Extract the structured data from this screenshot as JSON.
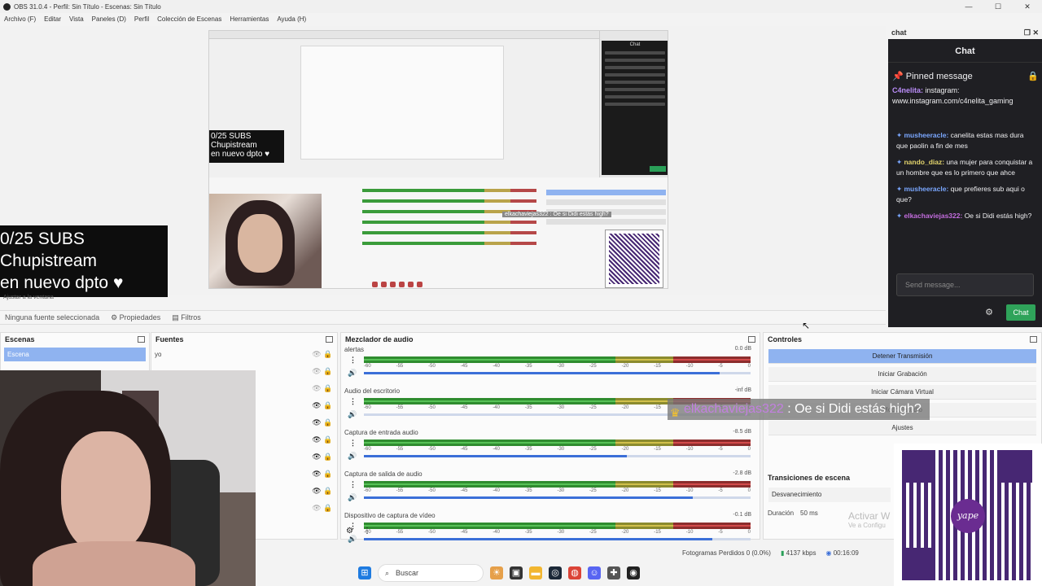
{
  "window": {
    "title": "OBS 31.0.4 - Perfil: Sin Título - Escenas: Sin Título",
    "menu": [
      "Archivo (F)",
      "Editar",
      "Vista",
      "Paneles (D)",
      "Perfil",
      "Colección de Escenas",
      "Herramientas",
      "Ayuda (H)"
    ]
  },
  "preview": {
    "subs_overlay": [
      "0/25 SUBS",
      "Chupistream",
      "en nuevo dpto ♥"
    ],
    "mini_chat_title": "Chat",
    "mini_alert": "elkachaviejas322 : Oe si Didi estás high?",
    "zoom_label": "Ajustar a la ventana"
  },
  "source_toolbar": {
    "no_source": "Ninguna fuente seleccionada",
    "properties": "Propiedades",
    "filters": "Filtros"
  },
  "scenes": {
    "title": "Escenas",
    "items": [
      "Escena"
    ]
  },
  "sources": {
    "title": "Fuentes",
    "items": [
      {
        "name": "yo"
      },
      {
        "name": ""
      },
      {
        "name": ""
      },
      {
        "name": ""
      },
      {
        "name": ""
      },
      {
        "name": ""
      },
      {
        "name": ""
      },
      {
        "name": ""
      },
      {
        "name": ""
      },
      {
        "name": ""
      }
    ]
  },
  "mixer": {
    "title": "Mezclador de audio",
    "channels": [
      {
        "name": "alertas",
        "db": "0.0 dB",
        "volume": 0.92
      },
      {
        "name": "Audio del escritorio",
        "db": "-inf dB",
        "volume": 0.0
      },
      {
        "name": "Captura de entrada audio",
        "db": "-8.5 dB",
        "volume": 0.68
      },
      {
        "name": "Captura de salida de audio",
        "db": "-2.8 dB",
        "volume": 0.85
      },
      {
        "name": "Dispositivo de captura de vídeo",
        "db": "-0.1 dB",
        "volume": 0.9
      }
    ],
    "scale": [
      "-60",
      "-55",
      "-50",
      "-45",
      "-40",
      "-35",
      "-30",
      "-25",
      "-20",
      "-15",
      "-10",
      "-5",
      "0"
    ]
  },
  "controls": {
    "title": "Controles",
    "buttons": [
      "Detener Transmisión",
      "Iniciar Grabación",
      "Iniciar Cámara Virtual",
      "Modo Estudio",
      "Ajustes"
    ],
    "transitions_title": "Transiciones de escena",
    "transition": "Desvanecimiento",
    "duration_label": "Duración",
    "duration_value": "50 ms",
    "activate_windows": "Activar W",
    "activate_sub": "Ve a Configu"
  },
  "overlay": {
    "user": "elkachaviejas322",
    "message": " : Oe si Didi estás high?"
  },
  "qr": {
    "brand": "yape"
  },
  "chat": {
    "dock_title": "chat",
    "title": "Chat",
    "pinned_title": "Pinned message",
    "pinned_user": "C4nelita:",
    "pinned_text": "instagram: www.instagram.com/c4nelita_gaming",
    "messages": [
      {
        "user": "musheeracle:",
        "text": " canelita estas mas dura que paolin a fin de mes",
        "color": "u-blue"
      },
      {
        "user": "nando_diaz:",
        "text": " una mujer para conquistar a un hombre que es lo primero que ahce",
        "color": "u-yellow"
      },
      {
        "user": "musheeracle:",
        "text": " que prefieres sub aqui o que?",
        "color": "u-blue"
      },
      {
        "user": "elkachaviejas322:",
        "text": " Oe si Didi estás high?",
        "color": "u-pink"
      }
    ],
    "input_placeholder": "Send message...",
    "send_label": "Chat"
  },
  "status": {
    "dropped": "Fotogramas Perdidos 0 (0.0%)",
    "bitrate": "4137 kbps",
    "time": "00:16:09"
  },
  "taskbar": {
    "search_placeholder": "Buscar"
  }
}
